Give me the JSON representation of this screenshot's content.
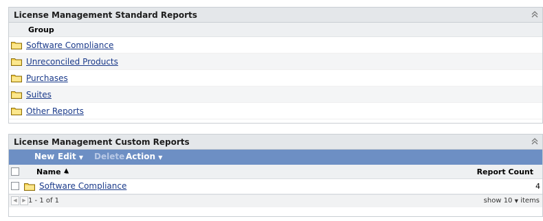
{
  "standard_panel": {
    "title": "License Management Standard Reports",
    "group_header": "Group",
    "items": [
      {
        "label": "Software Compliance"
      },
      {
        "label": "Unreconciled Products"
      },
      {
        "label": "Purchases"
      },
      {
        "label": "Suites"
      },
      {
        "label": "Other Reports"
      }
    ]
  },
  "custom_panel": {
    "title": "License Management Custom Reports",
    "toolbar": {
      "new": "New",
      "edit": "Edit",
      "delete": "Delete",
      "action": "Action"
    },
    "columns": {
      "name": "Name",
      "report_count": "Report Count"
    },
    "rows": [
      {
        "name": "Software Compliance",
        "count": "4"
      }
    ],
    "pager": {
      "range": "1 - 1 of 1",
      "show_prefix": "show",
      "page_size": "10",
      "show_suffix": "items"
    }
  },
  "colors": {
    "toolbar": "#6d8fc4",
    "header": "#e4e7ea",
    "link": "#1a3a8a",
    "folder": "#f5d04a"
  },
  "icons": {
    "folder": "folder-icon",
    "collapse": "collapse-double-chevron-up-icon",
    "sort": "sort-ascending-icon",
    "prev": "page-prev-icon",
    "next": "page-next-icon",
    "dropdown": "chevron-down-icon"
  }
}
